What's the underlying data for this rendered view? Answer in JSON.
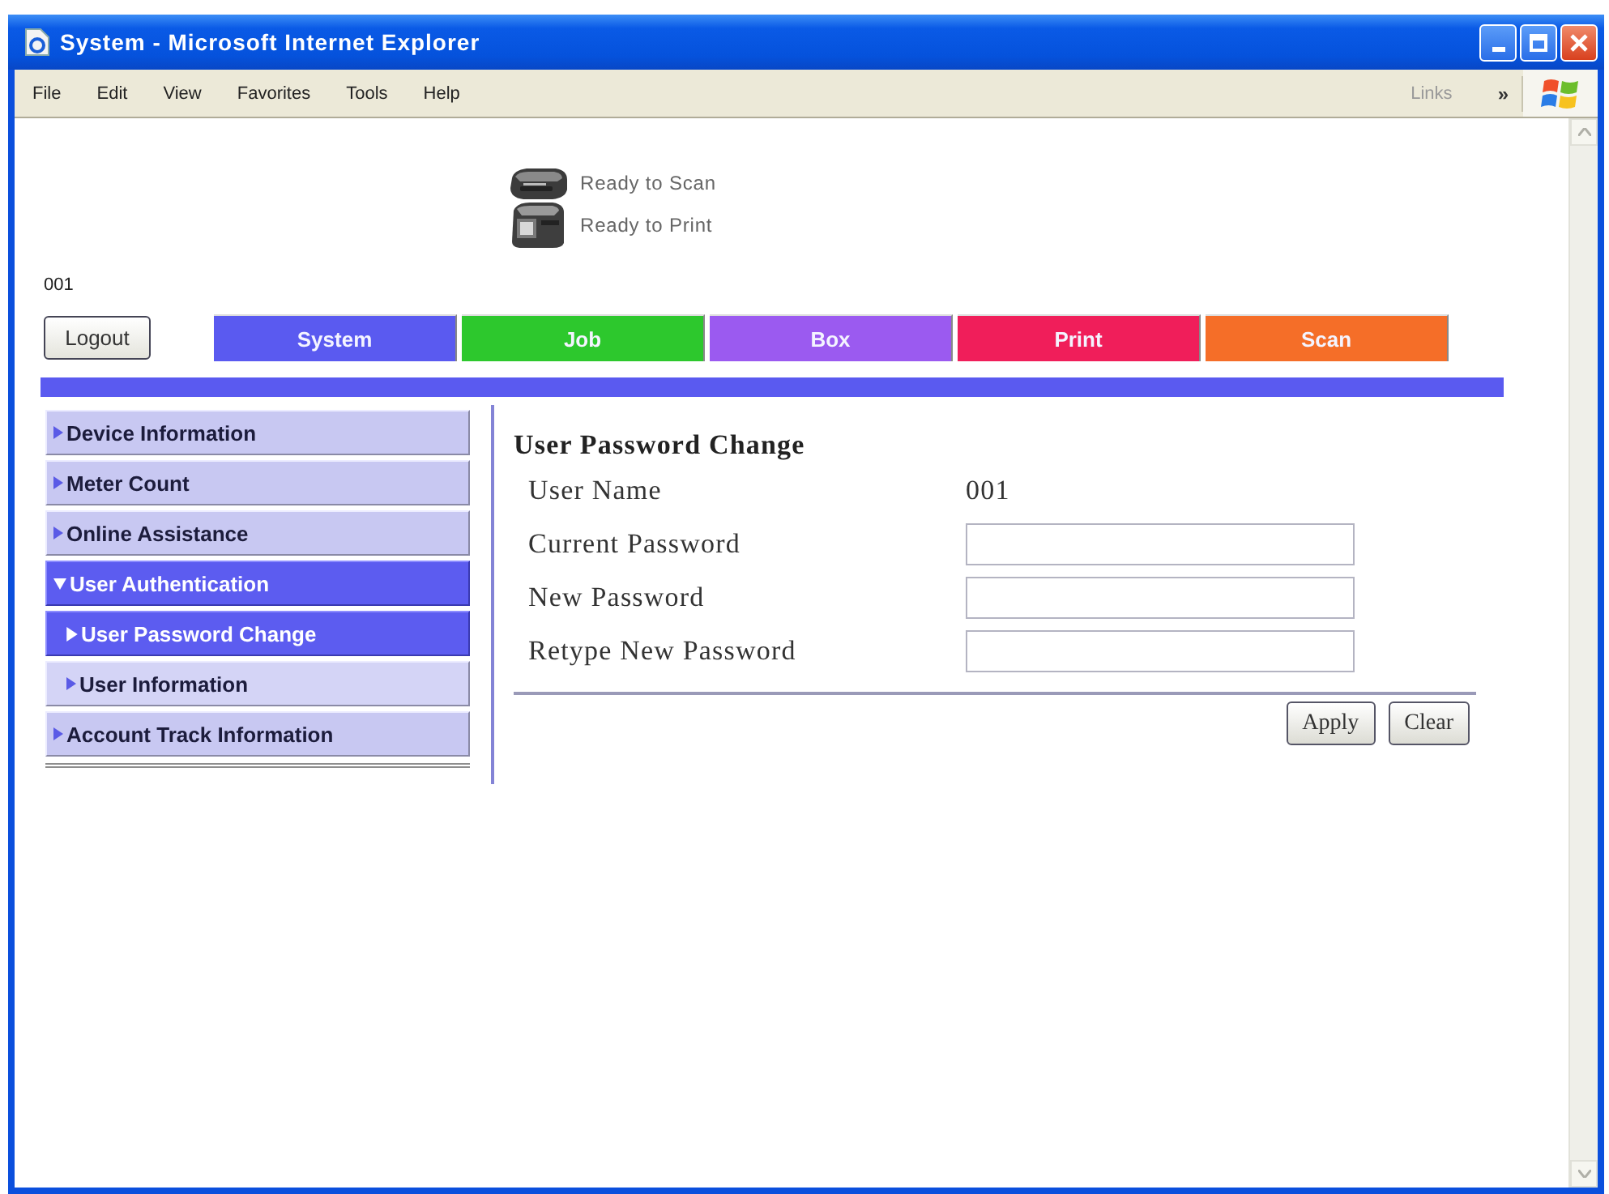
{
  "window": {
    "title": "System - Microsoft Internet Explorer"
  },
  "menu_bar": {
    "items": [
      "File",
      "Edit",
      "View",
      "Favorites",
      "Tools",
      "Help"
    ],
    "links": {
      "label": "Links",
      "chevron": "»"
    }
  },
  "status": [
    {
      "kind": "scanner",
      "text": "Ready to Scan"
    },
    {
      "kind": "printer",
      "text": "Ready to Print"
    }
  ],
  "user_id": "001",
  "logout_button": "Logout",
  "tabs": [
    {
      "label": "System",
      "color": "#5a5af0"
    },
    {
      "label": "Job",
      "color": "#2dc82d"
    },
    {
      "label": "Box",
      "color": "#9b5af0"
    },
    {
      "label": "Print",
      "color": "#f01e5a"
    },
    {
      "label": "Scan",
      "color": "#f56e28"
    }
  ],
  "sidebar": {
    "items": [
      {
        "label": "Device Information",
        "expanded": false,
        "selected": false
      },
      {
        "label": "Meter Count",
        "expanded": false,
        "selected": false
      },
      {
        "label": "Online Assistance",
        "expanded": false,
        "selected": false
      },
      {
        "label": "User Authentication",
        "expanded": true,
        "selected": true,
        "children": [
          {
            "label": "User Password Change",
            "selected": true
          },
          {
            "label": "User Information",
            "selected": false
          }
        ]
      },
      {
        "label": "Account Track Information",
        "expanded": false,
        "selected": false
      }
    ]
  },
  "form": {
    "title": "User Password Change",
    "rows": [
      {
        "kind": "text",
        "label": "User Name",
        "value": "001"
      },
      {
        "kind": "password",
        "label": "Current Password"
      },
      {
        "kind": "password",
        "label": "New Password"
      },
      {
        "kind": "password",
        "label": "Retype New Password"
      }
    ],
    "buttons": [
      "Apply",
      "Clear"
    ]
  }
}
